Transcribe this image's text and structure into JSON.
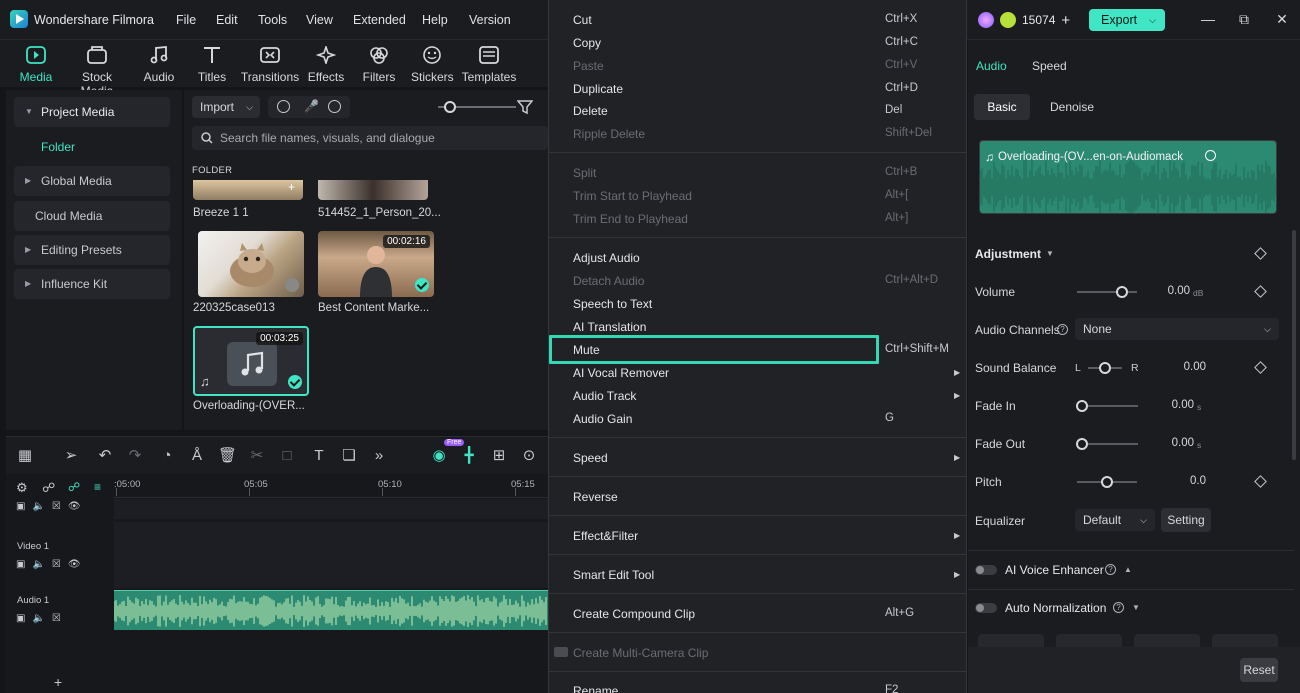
{
  "app": {
    "title": "Wondershare Filmora"
  },
  "menubar": [
    "File",
    "Edit",
    "Tools",
    "View",
    "Extended",
    "Help",
    "Version"
  ],
  "header": {
    "credits": "15074",
    "export_label": "Export"
  },
  "toolbar": {
    "items": [
      "Media",
      "Stock Media",
      "Audio",
      "Titles",
      "Transitions",
      "Effects",
      "Filters",
      "Stickers",
      "Templates"
    ],
    "active": "Media"
  },
  "leftnav": {
    "items": [
      "Project Media",
      "Global Media",
      "Cloud Media",
      "Editing Presets",
      "Influence Kit"
    ],
    "folder": "Folder"
  },
  "media": {
    "import_label": "Import",
    "search_placeholder": "Search file names, visuals, and dialogue",
    "folder_label": "FOLDER",
    "items": [
      {
        "name": "Breeze 1 1",
        "duration": ""
      },
      {
        "name": "514452_1_Person_20...",
        "duration": ""
      },
      {
        "name": "220325case013",
        "duration": ""
      },
      {
        "name": "Best Content Marke...",
        "duration": "00:02:16"
      },
      {
        "name": "Overloading-(OVER...",
        "duration": "00:03:25"
      }
    ]
  },
  "timeline": {
    "ruler": [
      ":05:00",
      "05:05",
      "05:10",
      "05:15"
    ],
    "tracks": [
      "Video 1",
      "Audio 1"
    ]
  },
  "context_menu": {
    "items": [
      {
        "label": "Cut",
        "shortcut": "Ctrl+X",
        "disabled": false
      },
      {
        "label": "Copy",
        "shortcut": "Ctrl+C",
        "disabled": false
      },
      {
        "label": "Paste",
        "shortcut": "Ctrl+V",
        "disabled": true
      },
      {
        "label": "Duplicate",
        "shortcut": "Ctrl+D",
        "disabled": false
      },
      {
        "label": "Delete",
        "shortcut": "Del",
        "disabled": false
      },
      {
        "label": "Ripple Delete",
        "shortcut": "Shift+Del",
        "disabled": true
      },
      {
        "label": "Split",
        "shortcut": "Ctrl+B",
        "disabled": true
      },
      {
        "label": "Trim Start to Playhead",
        "shortcut": "Alt+[",
        "disabled": true
      },
      {
        "label": "Trim End to Playhead",
        "shortcut": "Alt+]",
        "disabled": true
      },
      {
        "label": "Adjust Audio",
        "shortcut": "",
        "disabled": false
      },
      {
        "label": "Detach Audio",
        "shortcut": "Ctrl+Alt+D",
        "disabled": true
      },
      {
        "label": "Speech to Text",
        "shortcut": "",
        "disabled": false
      },
      {
        "label": "AI Translation",
        "shortcut": "",
        "disabled": false
      },
      {
        "label": "Mute",
        "shortcut": "Ctrl+Shift+M",
        "disabled": false
      },
      {
        "label": "AI Vocal Remover",
        "shortcut": "",
        "disabled": false
      },
      {
        "label": "Audio Track",
        "shortcut": "",
        "disabled": false
      },
      {
        "label": "Audio Gain",
        "shortcut": "G",
        "disabled": false
      },
      {
        "label": "Speed",
        "shortcut": "",
        "disabled": false
      },
      {
        "label": "Reverse",
        "shortcut": "",
        "disabled": false
      },
      {
        "label": "Effect&Filter",
        "shortcut": "",
        "disabled": false
      },
      {
        "label": "Smart Edit Tool",
        "shortcut": "",
        "disabled": false
      },
      {
        "label": "Create Compound Clip",
        "shortcut": "Alt+G",
        "disabled": false
      },
      {
        "label": "Create Multi-Camera Clip",
        "shortcut": "",
        "disabled": true
      },
      {
        "label": "Rename",
        "shortcut": "F2",
        "disabled": false
      }
    ]
  },
  "right_panel": {
    "tabs": [
      "Audio",
      "Speed"
    ],
    "subtabs": [
      "Basic",
      "Denoise"
    ],
    "clip_name": "Overloading-(OV...en-on-Audiomack",
    "adjustment_label": "Adjustment",
    "volume": {
      "label": "Volume",
      "value": "0.00",
      "unit": "dB",
      "level": 0.75
    },
    "audio_channels": {
      "label": "Audio Channels",
      "value": "None"
    },
    "sound_balance": {
      "label": "Sound Balance",
      "left": "L",
      "right": "R",
      "value": "0.00",
      "level": 0.5
    },
    "fade_in": {
      "label": "Fade In",
      "value": "0.00",
      "unit": "s",
      "level": 0
    },
    "fade_out": {
      "label": "Fade Out",
      "value": "0.00",
      "unit": "s",
      "level": 0
    },
    "pitch": {
      "label": "Pitch",
      "value": "0.0",
      "level": 0.5
    },
    "equalizer": {
      "label": "Equalizer",
      "value": "Default",
      "setting_label": "Setting"
    },
    "ai_voice_enhancer": "AI Voice Enhancer",
    "auto_normalization": "Auto Normalization",
    "reset_label": "Reset"
  },
  "colors": {
    "accent": "#3fe5c4",
    "waveform": "#2d8a72",
    "highlight": "#35d8b5"
  }
}
